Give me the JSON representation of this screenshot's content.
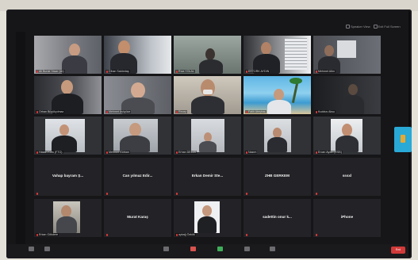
{
  "top_bar": {
    "speaker_view_label": "Speaker View",
    "fullscreen_label": "Exit Full Screen"
  },
  "participants_row1": [
    {
      "label": "Ali Burak Yasar (kb)"
    },
    {
      "label": "Cihan Saldırdaş"
    },
    {
      "label": "Rıza YOLAL"
    },
    {
      "label": "ERTÜRK AYDIN"
    },
    {
      "label": "Mehmet Altın"
    }
  ],
  "participants_row2": [
    {
      "label": "Orhan Büyükyılmaz"
    },
    {
      "label": "Mehmet Aslıyüce"
    },
    {
      "label": "Recep"
    },
    {
      "label": "Fatih Ateşbaş"
    },
    {
      "label": "Kuddus Aksu"
    }
  ],
  "participants_row3": [
    {
      "label": "Hasan Kuru (FTO)"
    },
    {
      "label": "Mehmet Gürkan"
    },
    {
      "label": "Erhan DEMİR"
    },
    {
      "label": "Nazım"
    },
    {
      "label": "Ercan Aydın (ESB)"
    }
  ],
  "participants_row4": [
    {
      "name": "Vahap bayram Ş..."
    },
    {
      "name": "Can yılmaz Edir..."
    },
    {
      "name": "Erkan Demir Ste..."
    },
    {
      "name": "ZHB GERKEM"
    },
    {
      "name": "sssxl"
    }
  ],
  "participants_row5": [
    {
      "label": "Erkan Gökdere"
    },
    {
      "name": "Murat Karaş"
    },
    {
      "label": "aykağ Özkök"
    },
    {
      "name": "sadettin onur k..."
    },
    {
      "name": "iPhone"
    }
  ],
  "toolbar": {
    "end_label": "End"
  }
}
